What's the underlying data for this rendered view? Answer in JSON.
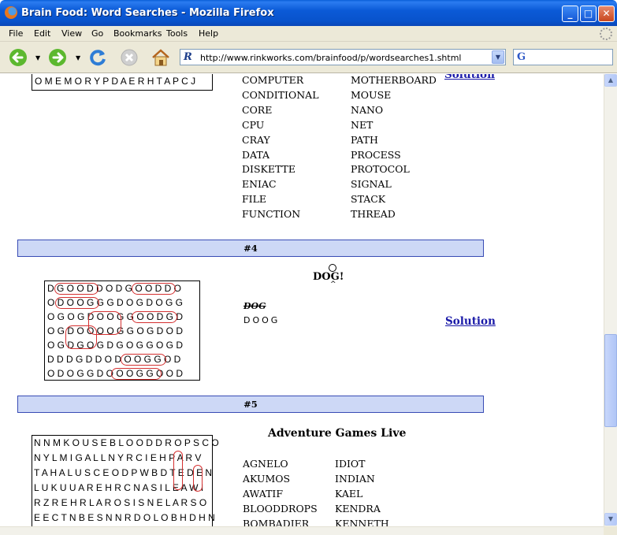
{
  "window": {
    "title": "Brain Food: Word Searches - Mozilla Firefox",
    "controls": {
      "minimize": "_",
      "maximize": "□",
      "close": "✕"
    }
  },
  "menu": [
    "File",
    "Edit",
    "View",
    "Go",
    "Bookmarks",
    "Tools",
    "Help"
  ],
  "toolbar": {
    "icons": [
      "back-icon",
      "forward-icon",
      "reload-icon",
      "stop-icon",
      "home-icon"
    ],
    "url": "http://www.rinkworks.com/brainfood/p/wordsearches1.shtml",
    "search_logo": "G"
  },
  "puzzle3": {
    "grid_last_row": "O M E M O R Y P D A E R H T A P C J",
    "words_col1": [
      "COMPUTER",
      "CONDITIONAL",
      "CORE",
      "CPU",
      "CRAY",
      "DATA",
      "DISKETTE",
      "ENIAC",
      "FILE",
      "FUNCTION"
    ],
    "words_col2": [
      "MOTHERBOARD",
      "MOUSE",
      "NANO",
      "NET",
      "PATH",
      "PROCESS",
      "PROTOCOL",
      "SIGNAL",
      "STACK",
      "THREAD"
    ],
    "solution_label": "Solution"
  },
  "puzzle4": {
    "header": "#4",
    "title": "DOG!",
    "grid": [
      "D G O O D D O D G O O D D O",
      "O D O O G G G D O G D O G G",
      "O G O G D O O G G O O D G D",
      "O G D O O O O G G O G D O D",
      "O G D G O G D G O G G O G D",
      "D D D G D D O D O O G G O D",
      "O D O G G D O O O G G O O D"
    ],
    "scribble_words": [
      "DOG",
      "DOOG"
    ],
    "solution_label": "Solution"
  },
  "puzzle5": {
    "header": "#5",
    "title": "Adventure Games Live",
    "grid": [
      "N N M K O U S E B L O O D D R O P S C O",
      "N Y L M I G A L L N Y R C I E H P A R V",
      "T A H A L U S C E O D P W B D T E D E N",
      "L U K U U A R E H R C N A S I L E A W I",
      "R Z R E H R L A R O S I S N E L A R S O",
      "E E C T N B E S N N R D O L O B H D H N"
    ],
    "words_col1": [
      "AGNELO",
      "AKUMOS",
      "AWATIF",
      "BLOODDROPS",
      "BOMBADIER"
    ],
    "words_col2": [
      "IDIOT",
      "INDIAN",
      "KAEL",
      "KENDRA",
      "KENNETH"
    ]
  }
}
